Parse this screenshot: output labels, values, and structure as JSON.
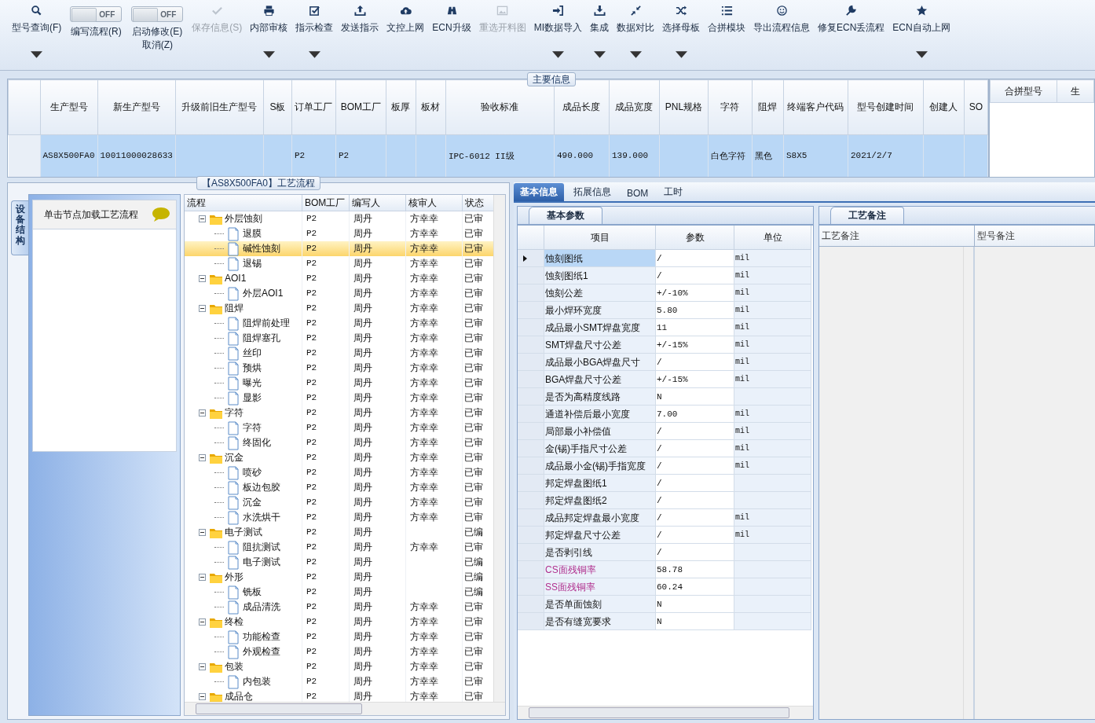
{
  "toolbar": [
    {
      "kind": "button",
      "label": "型号查询(F)",
      "disabled": false,
      "dropdown": true
    },
    {
      "kind": "toggle",
      "label": "编写流程(R)",
      "switch_text": "OFF",
      "on": false
    },
    {
      "kind": "toggle",
      "label": "启动修改(E)",
      "sublabel": "取消(Z)",
      "switch_text": "OFF",
      "on": false
    },
    {
      "kind": "button",
      "label": "保存信息(S)",
      "disabled": true,
      "dropdown": false
    },
    {
      "kind": "button",
      "label": "内部审核",
      "disabled": false,
      "dropdown": true
    },
    {
      "kind": "button",
      "label": "指示检查",
      "disabled": false,
      "dropdown": true
    },
    {
      "kind": "button",
      "label": "发送指示",
      "disabled": false,
      "dropdown": false
    },
    {
      "kind": "button",
      "label": "文控上网",
      "disabled": false,
      "dropdown": false
    },
    {
      "kind": "button",
      "label": "ECN升级",
      "disabled": false,
      "dropdown": false
    },
    {
      "kind": "button",
      "label": "重选开料图",
      "disabled": true,
      "dropdown": false
    },
    {
      "kind": "button",
      "label": "MI数据导入",
      "disabled": false,
      "dropdown": true
    },
    {
      "kind": "button",
      "label": "集成",
      "disabled": false,
      "dropdown": true
    },
    {
      "kind": "button",
      "label": "数据对比",
      "disabled": false,
      "dropdown": true
    },
    {
      "kind": "button",
      "label": "选择母板",
      "disabled": false,
      "dropdown": true
    },
    {
      "kind": "button",
      "label": "合拼模块",
      "disabled": false,
      "dropdown": false
    },
    {
      "kind": "button",
      "label": "导出流程信息",
      "disabled": false,
      "dropdown": false
    },
    {
      "kind": "button",
      "label": "修复ECN丢流程",
      "disabled": false,
      "dropdown": false
    },
    {
      "kind": "button",
      "label": "ECN自动上网",
      "disabled": false,
      "dropdown": true
    }
  ],
  "main_info": {
    "title": "主要信息",
    "columns": [
      "生产型号",
      "新生产型号",
      "升级前旧生产型号",
      "S板",
      "订单工厂",
      "BOM工厂",
      "板厚",
      "板材",
      "验收标准",
      "成品长度",
      "成品宽度",
      "PNL规格",
      "字符",
      "阻焊",
      "终端客户代码",
      "型号创建时间",
      "创建人",
      "SO"
    ],
    "rows": [
      {
        "selected": true,
        "cells": [
          "AS8X500FA0",
          "10011000028633",
          null,
          null,
          "P2",
          "P2",
          null,
          null,
          "IPC-6012 II级",
          "490.000",
          "139.000",
          null,
          "白色字符",
          "黑色",
          "S8X5",
          "2021/2/7",
          null,
          null
        ]
      }
    ],
    "merge_columns": [
      "合拼型号",
      "生"
    ]
  },
  "flow": {
    "title": "【AS8X500FA0】工艺流程",
    "side_tab": "设备结构",
    "hint": "单击节点加载工艺流程",
    "columns": [
      "流程",
      "BOM工厂",
      "编写人",
      "核审人",
      "状态"
    ],
    "nodes": [
      {
        "name": "外层蚀刻",
        "bom": "P2",
        "writer": "周丹",
        "reviewer": "方幸幸",
        "status": "已审",
        "expanded": true,
        "selected": false,
        "children": [
          {
            "name": "退膜",
            "bom": "P2",
            "writer": "周丹",
            "reviewer": "方幸幸",
            "status": "已审",
            "selected": false
          },
          {
            "name": "碱性蚀刻",
            "bom": "P2",
            "writer": "周丹",
            "reviewer": "方幸幸",
            "status": "已审",
            "selected": true
          },
          {
            "name": "退锡",
            "bom": "P2",
            "writer": "周丹",
            "reviewer": "方幸幸",
            "status": "已审",
            "selected": false
          }
        ]
      },
      {
        "name": "AOI1",
        "bom": "P2",
        "writer": "周丹",
        "reviewer": "方幸幸",
        "status": "已审",
        "expanded": true,
        "selected": false,
        "children": [
          {
            "name": "外层AOI1",
            "bom": "P2",
            "writer": "周丹",
            "reviewer": "方幸幸",
            "status": "已审",
            "selected": false
          }
        ]
      },
      {
        "name": "阻焊",
        "bom": "P2",
        "writer": "周丹",
        "reviewer": "方幸幸",
        "status": "已审",
        "expanded": true,
        "selected": false,
        "children": [
          {
            "name": "阻焊前处理",
            "bom": "P2",
            "writer": "周丹",
            "reviewer": "方幸幸",
            "status": "已审",
            "selected": false
          },
          {
            "name": "阻焊塞孔",
            "bom": "P2",
            "writer": "周丹",
            "reviewer": "方幸幸",
            "status": "已审",
            "selected": false
          },
          {
            "name": "丝印",
            "bom": "P2",
            "writer": "周丹",
            "reviewer": "方幸幸",
            "status": "已审",
            "selected": false
          },
          {
            "name": "预烘",
            "bom": "P2",
            "writer": "周丹",
            "reviewer": "方幸幸",
            "status": "已审",
            "selected": false
          },
          {
            "name": "曝光",
            "bom": "P2",
            "writer": "周丹",
            "reviewer": "方幸幸",
            "status": "已审",
            "selected": false
          },
          {
            "name": "显影",
            "bom": "P2",
            "writer": "周丹",
            "reviewer": "方幸幸",
            "status": "已审",
            "selected": false
          }
        ]
      },
      {
        "name": "字符",
        "bom": "P2",
        "writer": "周丹",
        "reviewer": "方幸幸",
        "status": "已审",
        "expanded": true,
        "selected": false,
        "children": [
          {
            "name": "字符",
            "bom": "P2",
            "writer": "周丹",
            "reviewer": "方幸幸",
            "status": "已审",
            "selected": false
          },
          {
            "name": "终固化",
            "bom": "P2",
            "writer": "周丹",
            "reviewer": "方幸幸",
            "status": "已审",
            "selected": false
          }
        ]
      },
      {
        "name": "沉金",
        "bom": "P2",
        "writer": "周丹",
        "reviewer": "方幸幸",
        "status": "已审",
        "expanded": true,
        "selected": false,
        "children": [
          {
            "name": "喷砂",
            "bom": "P2",
            "writer": "周丹",
            "reviewer": "方幸幸",
            "status": "已审",
            "selected": false
          },
          {
            "name": "板边包胶",
            "bom": "P2",
            "writer": "周丹",
            "reviewer": "方幸幸",
            "status": "已审",
            "selected": false
          },
          {
            "name": "沉金",
            "bom": "P2",
            "writer": "周丹",
            "reviewer": "方幸幸",
            "status": "已审",
            "selected": false
          },
          {
            "name": "水洗烘干",
            "bom": "P2",
            "writer": "周丹",
            "reviewer": "方幸幸",
            "status": "已审",
            "selected": false
          }
        ]
      },
      {
        "name": "电子测试",
        "bom": "P2",
        "writer": "周丹",
        "status": "已编",
        "expanded": true,
        "selected": false,
        "children": [
          {
            "name": "阻抗测试",
            "bom": "P2",
            "writer": "周丹",
            "reviewer": "方幸幸",
            "status": "已审",
            "selected": false
          },
          {
            "name": "电子测试",
            "bom": "P2",
            "writer": "周丹",
            "status": "已编",
            "selected": false
          }
        ]
      },
      {
        "name": "外形",
        "bom": "P2",
        "writer": "周丹",
        "status": "已编",
        "expanded": true,
        "selected": false,
        "children": [
          {
            "name": "铣板",
            "bom": "P2",
            "writer": "周丹",
            "status": "已编",
            "selected": false
          },
          {
            "name": "成品清洗",
            "bom": "P2",
            "writer": "周丹",
            "reviewer": "方幸幸",
            "status": "已审",
            "selected": false
          }
        ]
      },
      {
        "name": "终检",
        "bom": "P2",
        "writer": "周丹",
        "reviewer": "方幸幸",
        "status": "已审",
        "expanded": true,
        "selected": false,
        "children": [
          {
            "name": "功能检查",
            "bom": "P2",
            "writer": "周丹",
            "reviewer": "方幸幸",
            "status": "已审",
            "selected": false
          },
          {
            "name": "外观检查",
            "bom": "P2",
            "writer": "周丹",
            "reviewer": "方幸幸",
            "status": "已审",
            "selected": false
          }
        ]
      },
      {
        "name": "包装",
        "bom": "P2",
        "writer": "周丹",
        "reviewer": "方幸幸",
        "status": "已审",
        "expanded": true,
        "selected": false,
        "children": [
          {
            "name": "内包装",
            "bom": "P2",
            "writer": "周丹",
            "reviewer": "方幸幸",
            "status": "已审",
            "selected": false
          }
        ]
      },
      {
        "name": "成品仓",
        "bom": "P2",
        "writer": "周丹",
        "reviewer": "方幸幸",
        "status": "已审",
        "expanded": true,
        "selected": false
      }
    ]
  },
  "detail_tabs": [
    {
      "label": "基本信息",
      "selected": true
    },
    {
      "label": "拓展信息",
      "selected": false
    },
    {
      "label": "BOM",
      "selected": false
    },
    {
      "label": "工时",
      "selected": false
    }
  ],
  "params": {
    "tab": "基本参数",
    "columns": [
      "项目",
      "参数",
      "单位"
    ],
    "rows": [
      {
        "item": "蚀刻图纸",
        "value": "/",
        "unit": "mil",
        "selected": true,
        "flagged": false
      },
      {
        "item": "蚀刻图纸1",
        "value": "/",
        "unit": "mil",
        "selected": false,
        "flagged": false
      },
      {
        "item": "蚀刻公差",
        "value": "+/-10%",
        "unit": "mil",
        "selected": false,
        "flagged": false
      },
      {
        "item": "最小焊环宽度",
        "value": "5.80",
        "unit": "mil",
        "selected": false,
        "flagged": false
      },
      {
        "item": "成品最小SMT焊盘宽度",
        "value": "11",
        "unit": "mil",
        "selected": false,
        "flagged": false
      },
      {
        "item": "SMT焊盘尺寸公差",
        "value": "+/-15%",
        "unit": "mil",
        "selected": false,
        "flagged": false
      },
      {
        "item": "成品最小BGA焊盘尺寸",
        "value": "/",
        "unit": "mil",
        "selected": false,
        "flagged": false
      },
      {
        "item": "BGA焊盘尺寸公差",
        "value": "+/-15%",
        "unit": "mil",
        "selected": false,
        "flagged": false
      },
      {
        "item": "是否为高精度线路",
        "value": "N",
        "unit": null,
        "selected": false,
        "flagged": false
      },
      {
        "item": "通道补偿后最小宽度",
        "value": "7.00",
        "unit": "mil",
        "selected": false,
        "flagged": false
      },
      {
        "item": "局部最小补偿值",
        "value": "/",
        "unit": "mil",
        "selected": false,
        "flagged": false
      },
      {
        "item": "金(锡)手指尺寸公差",
        "value": "/",
        "unit": "mil",
        "selected": false,
        "flagged": false
      },
      {
        "item": "成品最小金(锡)手指宽度",
        "value": "/",
        "unit": "mil",
        "selected": false,
        "flagged": false
      },
      {
        "item": "邦定焊盘图纸1",
        "value": "/",
        "unit": null,
        "selected": false,
        "flagged": false
      },
      {
        "item": "邦定焊盘图纸2",
        "value": "/",
        "unit": null,
        "selected": false,
        "flagged": false
      },
      {
        "item": "成品邦定焊盘最小宽度",
        "value": "/",
        "unit": "mil",
        "selected": false,
        "flagged": false
      },
      {
        "item": "邦定焊盘尺寸公差",
        "value": "/",
        "unit": "mil",
        "selected": false,
        "flagged": false
      },
      {
        "item": "是否剥引线",
        "value": "/",
        "unit": null,
        "selected": false,
        "flagged": false
      },
      {
        "item": "CS面残铜率",
        "value": "58.78",
        "unit": null,
        "selected": false,
        "flagged": true
      },
      {
        "item": "SS面残铜率",
        "value": "60.24",
        "unit": null,
        "selected": false,
        "flagged": true
      },
      {
        "item": "是否单面蚀刻",
        "value": "N",
        "unit": null,
        "selected": false,
        "flagged": false
      },
      {
        "item": "是否有缝宽要求",
        "value": "N",
        "unit": null,
        "selected": false,
        "flagged": false
      }
    ]
  },
  "notes": {
    "tab": "工艺备注",
    "columns": [
      "工艺备注",
      "型号备注"
    ]
  }
}
